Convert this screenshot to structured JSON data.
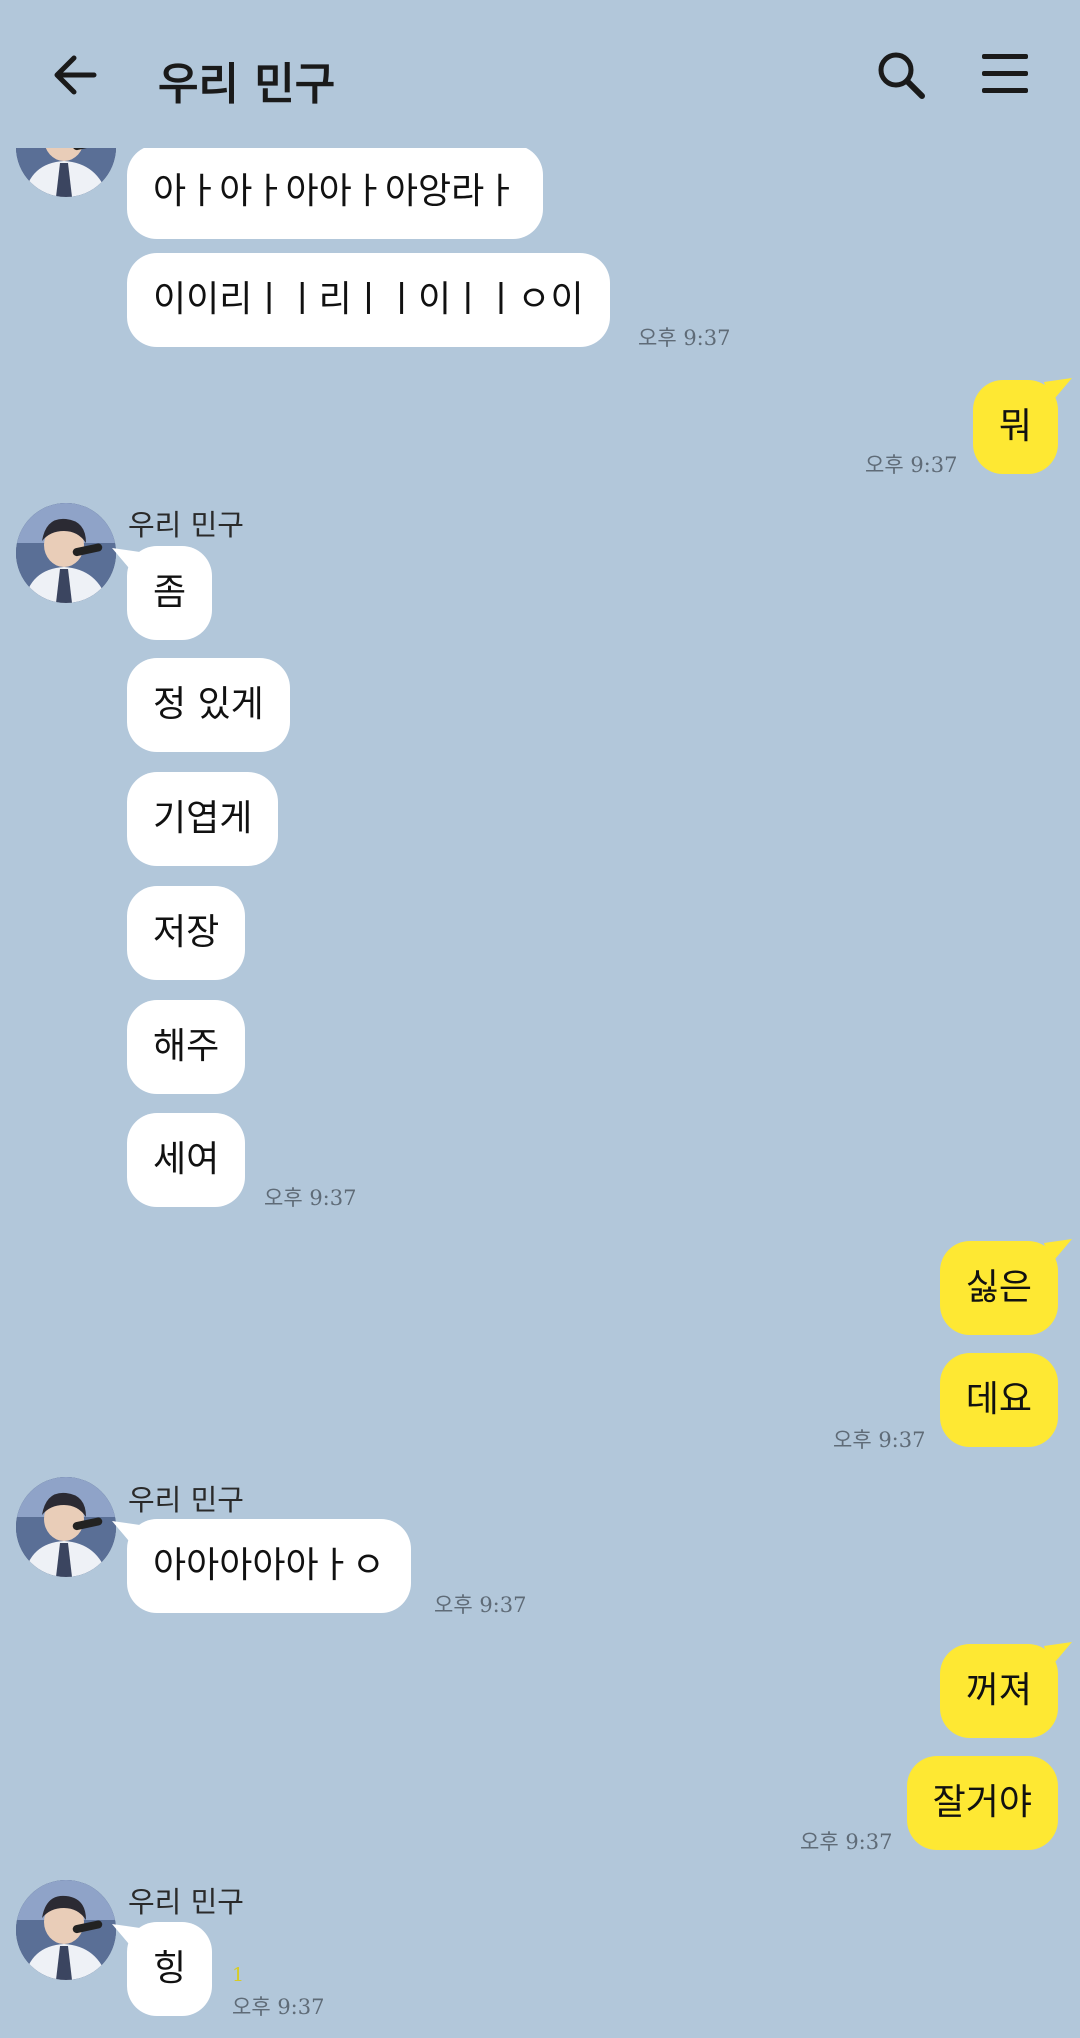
{
  "header": {
    "title": "우리 민구"
  },
  "messages": {
    "m1": "아ㅏ아ㅏ아아ㅏ아앙라ㅏ",
    "m2": "이이리ㅣㅣ리ㅣㅣ이ㅣㅣㅇ이",
    "m2_time": "오후 9:37",
    "m3": "뭐",
    "m3_time": "오후 9:37",
    "g2_name": "우리 민구",
    "m4": "좀",
    "m5": "정 있게",
    "m6": "기엽게",
    "m7": "저장",
    "m8": "해주",
    "m9": "세여",
    "m9_time": "오후 9:37",
    "m10": "싫은",
    "m11": "데요",
    "m11_time": "오후 9:37",
    "g4_name": "우리 민구",
    "m12": "아아아아아ㅏㅇ",
    "m12_time": "오후 9:37",
    "m13": "꺼져",
    "m14": "잘거야",
    "m14_time": "오후 9:37",
    "g6_name": "우리 민구",
    "m15": "힝",
    "m15_unread": "1",
    "m15_time": "오후 9:37"
  },
  "colors": {
    "background": "#b2c7da",
    "incoming_bubble": "#ffffff",
    "outgoing_bubble": "#fee833"
  },
  "icons": [
    "back-arrow-icon",
    "search-icon",
    "menu-icon"
  ]
}
